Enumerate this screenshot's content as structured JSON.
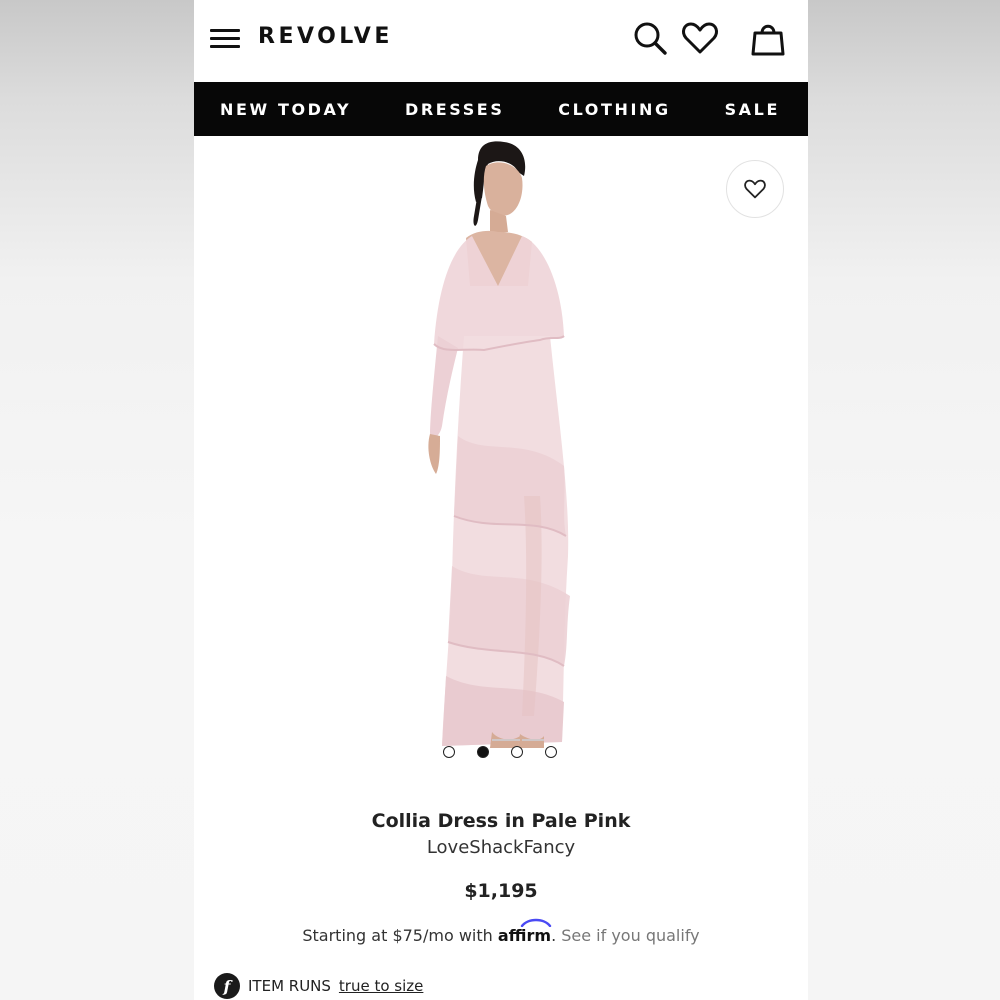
{
  "header": {
    "logo": "REVOLVE",
    "icons": [
      "menu-icon",
      "search-icon",
      "heart-icon",
      "shopping-bag-icon"
    ]
  },
  "nav": {
    "items": [
      {
        "label": "NEW TODAY"
      },
      {
        "label": "DRESSES"
      },
      {
        "label": "CLOTHING"
      },
      {
        "label": "SALE"
      }
    ]
  },
  "gallery": {
    "image_count": 4,
    "active_index": 1,
    "dress_color": "#f2dde0"
  },
  "product": {
    "name": "Collia Dress in Pale Pink",
    "brand": "LoveShackFancy",
    "price": "$1,195",
    "financing": {
      "prefix": "Starting at $75/mo with ",
      "provider": "affirm",
      "separator": ".",
      "link": " See if you qualify"
    },
    "fit": {
      "logo_letter": "f",
      "label": "ITEM RUNS",
      "value": "true to size"
    }
  },
  "colors": {
    "nav_background": "#070707",
    "accent_affirm": "#4a4af4"
  }
}
